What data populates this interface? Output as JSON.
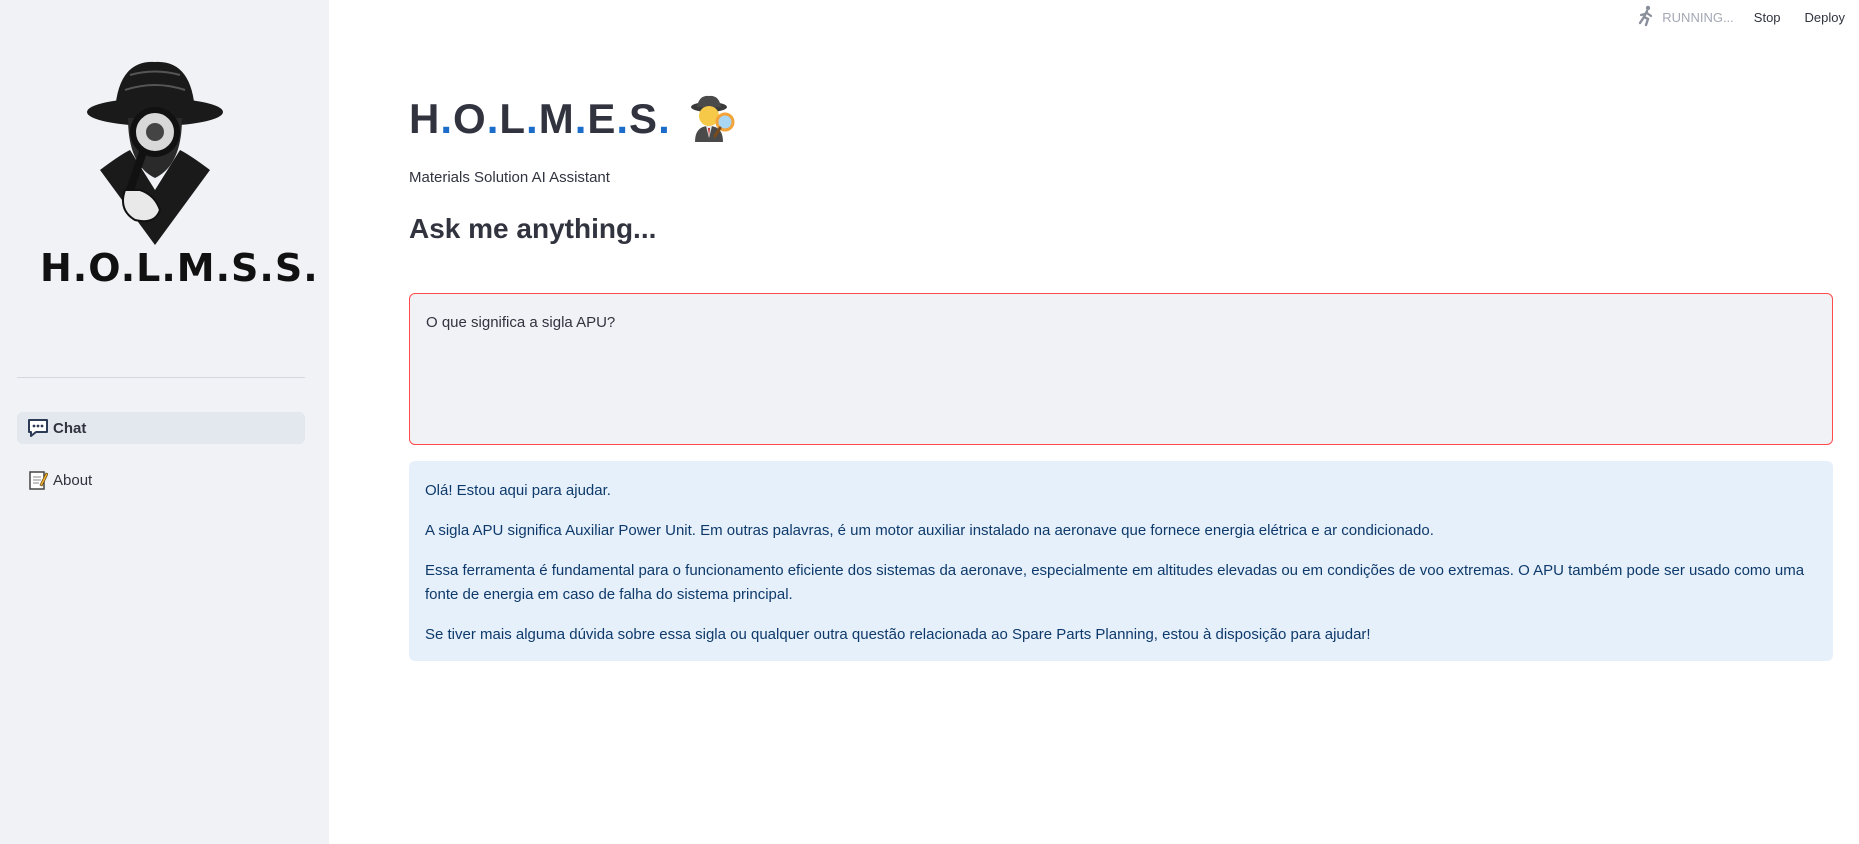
{
  "sidebar": {
    "logo_text": "H.O.L.M.S.S.",
    "nav": [
      {
        "label": "Chat",
        "icon": "chat-bubble-icon",
        "active": true
      },
      {
        "label": "About",
        "icon": "memo-icon",
        "active": false
      }
    ]
  },
  "topbar": {
    "status": "RUNNING...",
    "stop_label": "Stop",
    "deploy_label": "Deploy"
  },
  "main": {
    "title_parts": [
      "H",
      ".",
      "O",
      ".",
      "L",
      ".",
      "M",
      ".",
      "E",
      ".",
      "S",
      "."
    ],
    "title_emoji": "detective-icon",
    "subtitle": "Materials Solution AI Assistant",
    "heading": "Ask me anything...",
    "question": "O que significa a sigla APU?",
    "response": [
      "Olá! Estou aqui para ajudar.",
      "A sigla APU significa Auxiliar Power Unit. Em outras palavras, é um motor auxiliar instalado na aeronave que fornece energia elétrica e ar condicionado.",
      "Essa ferramenta é fundamental para o funcionamento eficiente dos sistemas da aeronave, especialmente em altitudes elevadas ou em condições de voo extremas. O APU também pode ser usado como uma fonte de energia em caso de falha do sistema principal.",
      "Se tiver mais alguma dúvida sobre essa sigla ou qualquer outra questão relacionada ao Spare Parts Planning, estou à disposição para ajudar!"
    ]
  },
  "colors": {
    "accent_blue": "#1c6cc9",
    "input_border": "#ff4b4b",
    "sidebar_bg": "#f0f2f6",
    "response_bg": "#e6f0fb"
  }
}
